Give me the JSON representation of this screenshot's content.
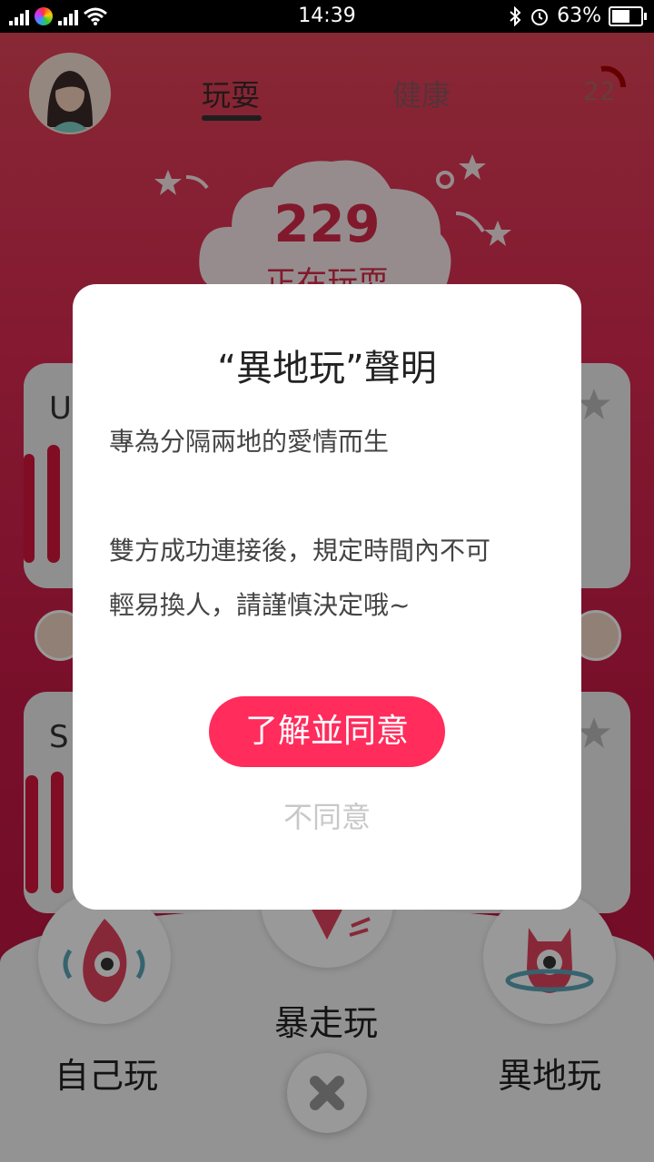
{
  "status_bar": {
    "time": "14:39",
    "battery": "63%",
    "battery_level": 0.63,
    "icons": [
      "signal-icon",
      "app-badge-icon",
      "signal-icon",
      "wifi-icon",
      "bluetooth-icon",
      "alarm-icon",
      "battery-icon"
    ]
  },
  "header": {
    "tab_play": "玩耍",
    "tab_health": "健康",
    "counter": "22"
  },
  "cloud": {
    "count": "229",
    "label": "正在玩耍"
  },
  "cards": {
    "top_label": "U",
    "bottom_label": "S"
  },
  "bottom_nav": {
    "self_play": "自己玩",
    "crazy_play": "暴走玩",
    "remote_play": "異地玩"
  },
  "dialog": {
    "title": "“異地玩”聲明",
    "line1": "專為分隔兩地的愛情而生",
    "line2": "雙方成功連接後，規定時間內不可",
    "line3": "輕易換人，請謹慎決定哦~",
    "agree": "了解並同意",
    "disagree": "不同意"
  },
  "colors": {
    "accent": "#ff2c5c",
    "background_gradient_top": "#e4465a",
    "background_gradient_bottom": "#b8133f"
  }
}
